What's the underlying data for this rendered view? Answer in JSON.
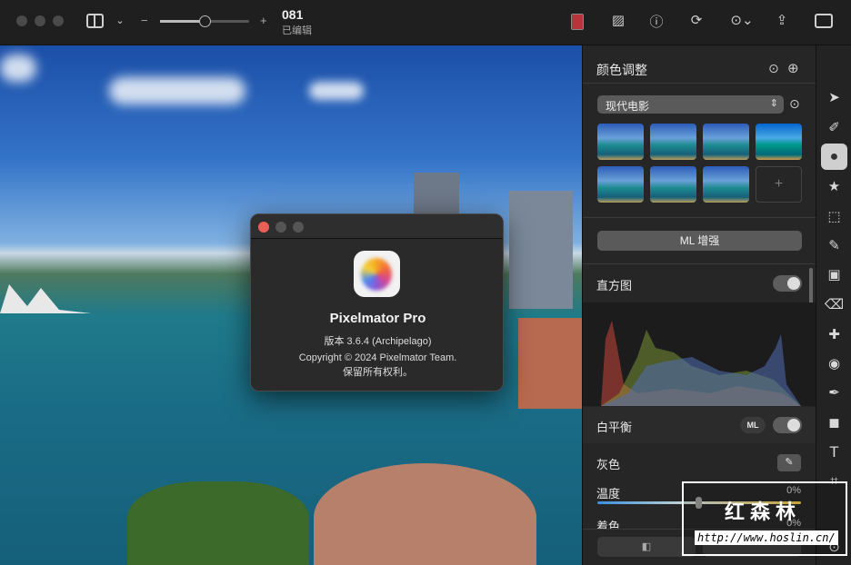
{
  "toolbar": {
    "doc_name": "081",
    "doc_status": "已编辑",
    "zoom_minus": "−",
    "zoom_plus": "+",
    "zoom_level": 0.5
  },
  "panel": {
    "title": "颜色调整",
    "preset": "现代电影",
    "add_preset": "+",
    "ml_enhance": "ML 增强",
    "histogram": {
      "label": "直方图",
      "enabled": true
    },
    "white_balance": {
      "label": "白平衡",
      "ml_badge": "ML",
      "enabled": true,
      "gray_label": "灰色",
      "temp_label": "温度",
      "temp_value": "0%",
      "tint_label": "着色",
      "tint_value": "0%"
    }
  },
  "about": {
    "app_name": "Pixelmator Pro",
    "version": "版本 3.6.4 (Archipelago)",
    "copyright": "Copyright © 2024 Pixelmator Team.",
    "rights": "保留所有权利。"
  },
  "watermark": {
    "name": "红森林",
    "url": "http://www.hoslin.cn/"
  },
  "colors": {
    "accent_red": "#b8333a",
    "toggle_on": "#5d5d5d"
  }
}
